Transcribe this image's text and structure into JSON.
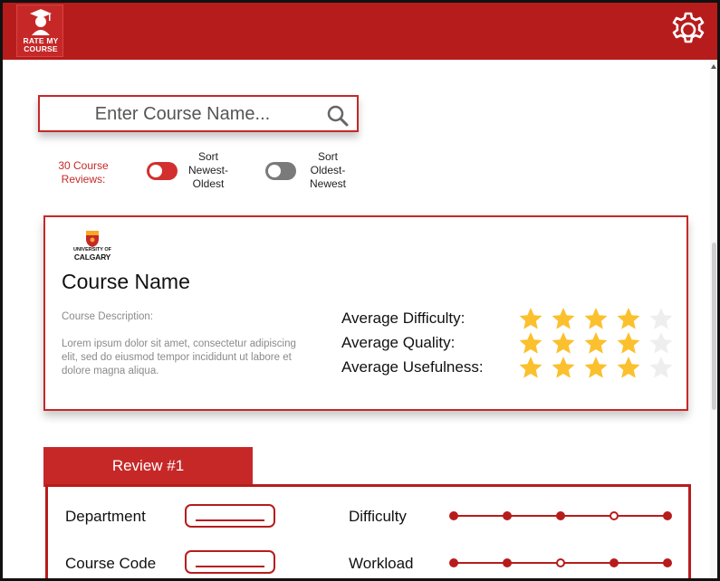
{
  "header": {
    "logo_text_line1": "RATE MY",
    "logo_text_line2": "COURSE",
    "logo_icon": "graduate-icon",
    "settings_icon": "gear-icon"
  },
  "search": {
    "placeholder": "Enter Course Name...",
    "value": "",
    "icon": "search-icon"
  },
  "reviews_summary": {
    "count_line1": "30 Course",
    "count_line2": "Reviews:"
  },
  "sort": {
    "newest_first": {
      "line1": "Sort",
      "line2": "Newest-",
      "line3": "Oldest",
      "on": true
    },
    "oldest_first": {
      "line1": "Sort",
      "line2": "Oldest-",
      "line3": "Newest",
      "on": false
    }
  },
  "course": {
    "university_line1": "UNIVERSITY OF",
    "university_line2": "CALGARY",
    "name": "Course Name",
    "description_label": "Course Description:",
    "description": "Lorem ipsum dolor sit amet, consectetur adipiscing elit, sed do eiusmod tempor incididunt ut labore et dolore magna aliqua.",
    "ratings": [
      {
        "label": "Average Difficulty:",
        "stars": 4,
        "max": 5
      },
      {
        "label": "Average Quality:",
        "stars": 4,
        "max": 5
      },
      {
        "label": "Average Usefulness:",
        "stars": 4,
        "max": 5
      }
    ]
  },
  "review": {
    "tab_label": "Review #1",
    "department_label": "Department",
    "department_value": "",
    "course_code_label": "Course Code",
    "course_code_value": "",
    "difficulty_label": "Difficulty",
    "difficulty_level": 4,
    "workload_label": "Workload",
    "workload_level": 3,
    "scale_points": 5
  },
  "colors": {
    "brand": "#b71c1c",
    "accent": "#c62828",
    "star": "#fbc02d",
    "star_empty": "#eeeeee"
  }
}
